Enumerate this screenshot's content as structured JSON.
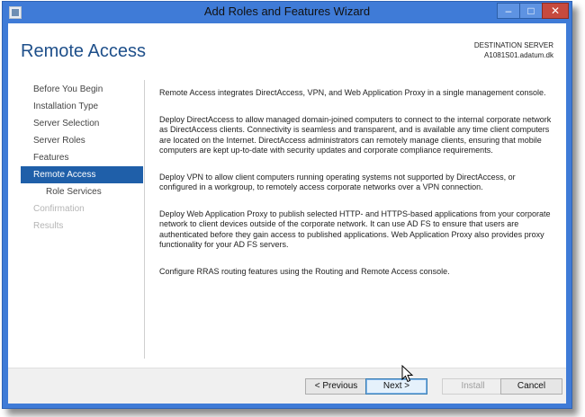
{
  "window": {
    "title": "Add Roles and Features Wizard"
  },
  "page_title": "Remote Access",
  "destination": {
    "label": "DESTINATION SERVER",
    "server": "A1081S01.adatum.dk"
  },
  "nav": [
    {
      "label": "Before You Begin",
      "state": "normal"
    },
    {
      "label": "Installation Type",
      "state": "normal"
    },
    {
      "label": "Server Selection",
      "state": "normal"
    },
    {
      "label": "Server Roles",
      "state": "normal"
    },
    {
      "label": "Features",
      "state": "normal"
    },
    {
      "label": "Remote Access",
      "state": "selected"
    },
    {
      "label": "Role Services",
      "state": "sub"
    },
    {
      "label": "Confirmation",
      "state": "disabled"
    },
    {
      "label": "Results",
      "state": "disabled"
    }
  ],
  "content": {
    "p1": "Remote Access integrates DirectAccess, VPN, and Web Application Proxy in a single management console.",
    "p2": "Deploy DirectAccess to allow managed domain-joined computers to connect to the internal corporate network as DirectAccess clients. Connectivity is seamless and transparent, and is available any time client computers are located on the Internet. DirectAccess administrators can remotely manage clients, ensuring that mobile computers are kept up-to-date with security updates and corporate compliance requirements.",
    "p3": "Deploy VPN to allow client computers running operating systems not supported by DirectAccess, or configured in a workgroup, to remotely access corporate networks over a VPN connection.",
    "p4": "Deploy Web Application Proxy to publish selected HTTP- and HTTPS-based applications from your corporate network to client devices outside of the corporate network. It can use AD FS to ensure that users are authenticated before they gain access to published applications. Web Application Proxy also provides proxy functionality for your AD FS servers.",
    "p5": "Configure RRAS routing features using the Routing and Remote Access console."
  },
  "buttons": {
    "previous": "< Previous",
    "next": "Next >",
    "install": "Install",
    "cancel": "Cancel"
  },
  "window_controls": {
    "minimize": "–",
    "maximize": "□",
    "close": "✕"
  },
  "colors": {
    "titlebar": "#3f7bd7",
    "selected_nav": "#1f5fa9",
    "page_title": "#1e4f8a"
  }
}
